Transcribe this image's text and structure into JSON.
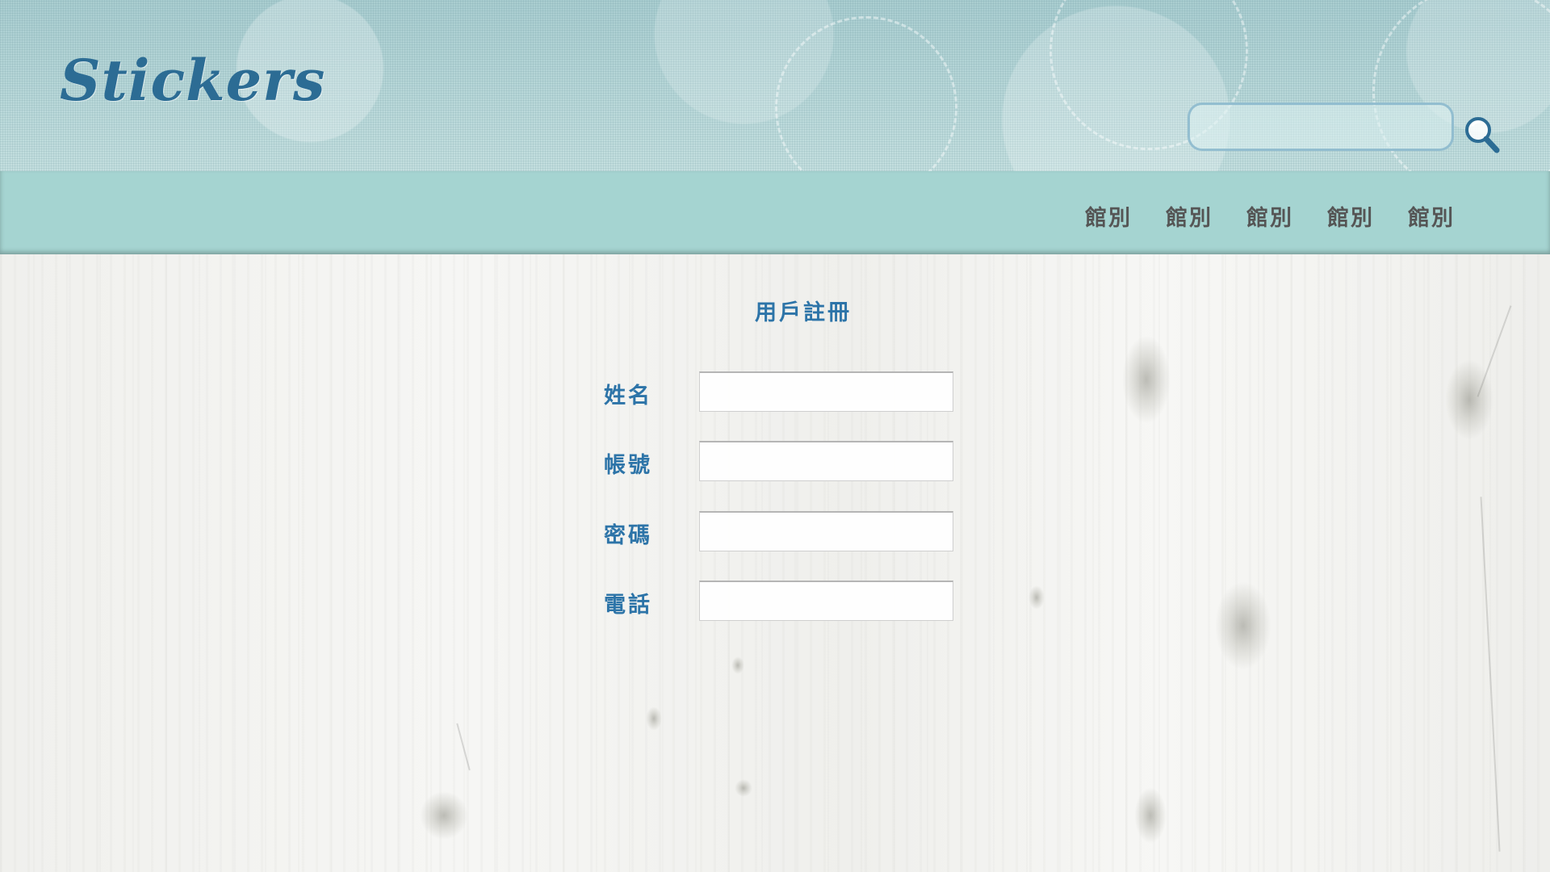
{
  "header": {
    "logo": "Stickers",
    "search": {
      "value": "",
      "placeholder": ""
    },
    "search_icon": "magnifier-icon"
  },
  "nav": {
    "items": [
      {
        "label": "館別"
      },
      {
        "label": "館別"
      },
      {
        "label": "館別"
      },
      {
        "label": "館別"
      },
      {
        "label": "館別"
      }
    ]
  },
  "form": {
    "title": "用戶註冊",
    "fields": [
      {
        "label": "姓名",
        "value": ""
      },
      {
        "label": "帳號",
        "value": ""
      },
      {
        "label": "密碼",
        "value": ""
      },
      {
        "label": "電話",
        "value": ""
      }
    ]
  },
  "colors": {
    "logo": "#2c6c94",
    "navbar": "#a5d4d1",
    "nav_text": "#555555",
    "form_text": "#2d74a8"
  }
}
